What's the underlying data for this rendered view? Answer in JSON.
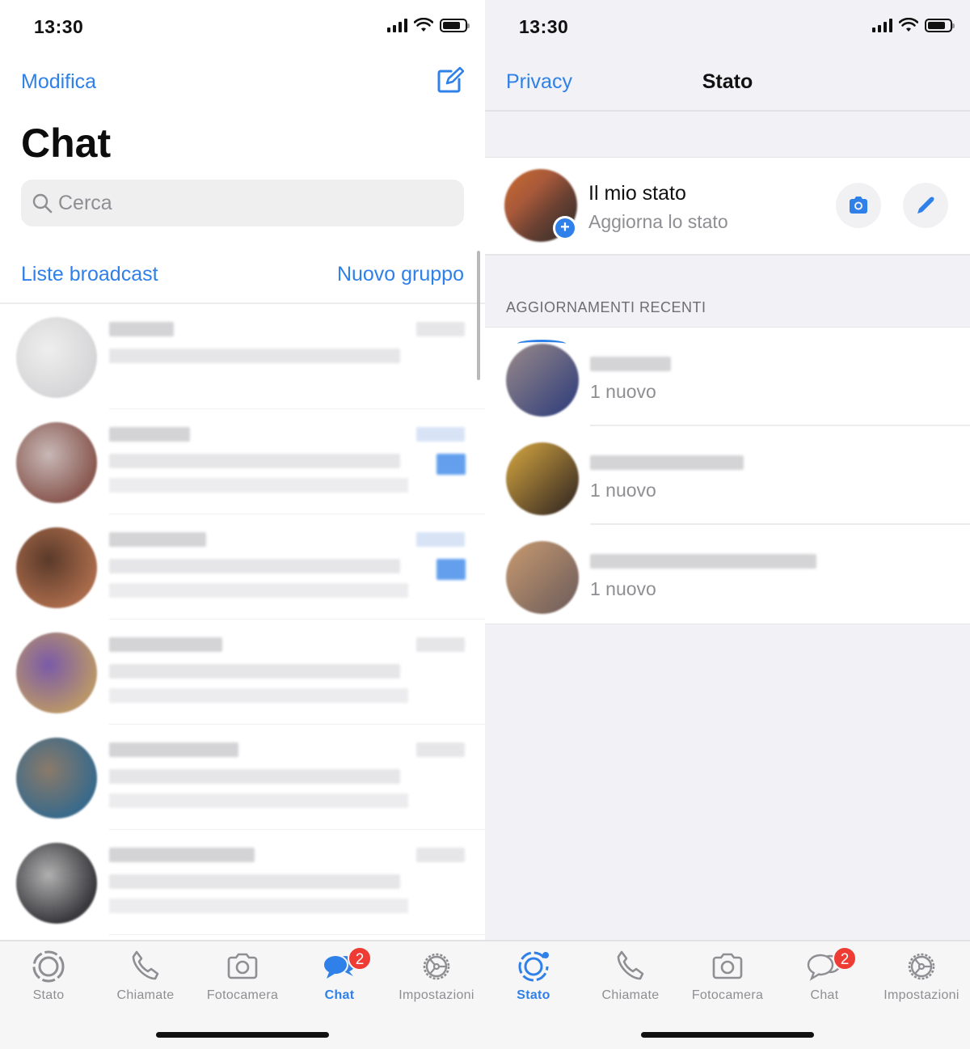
{
  "status_bar": {
    "time": "13:30"
  },
  "chat_screen": {
    "edit_label": "Modifica",
    "title": "Chat",
    "search_placeholder": "Cerca",
    "broadcast_label": "Liste broadcast",
    "new_group_label": "Nuovo gruppo",
    "chats": [
      {
        "name": "[blurred]",
        "preview": "[blurred]",
        "avatar_colors": [
          "#d6d6d8",
          "#eeeeee"
        ]
      },
      {
        "name": "[blurred]",
        "preview": "[blurred]",
        "avatar_colors": [
          "#8a5a52",
          "#c8b8b6"
        ],
        "unread": true
      },
      {
        "name": "[blurred]",
        "preview": "[blurred]",
        "avatar_colors": [
          "#a86a4a",
          "#5a3a2a"
        ],
        "unread": true
      },
      {
        "name": "[blurred]",
        "preview": "[blurred]",
        "avatar_colors": [
          "#b8956a",
          "#7a5aa8"
        ]
      },
      {
        "name": "[blurred]",
        "preview": "[blurred]",
        "avatar_colors": [
          "#3a6a8a",
          "#8a7a6a"
        ]
      },
      {
        "name": "[blurred]",
        "preview": "[blurred]",
        "avatar_colors": [
          "#3a3a3e",
          "#b0b0b0"
        ]
      }
    ]
  },
  "status_screen": {
    "privacy_label": "Privacy",
    "title": "Stato",
    "my_status": {
      "name": "Il mio stato",
      "subtitle": "Aggiorna lo stato"
    },
    "section_header": "AGGIORNAMENTI RECENTI",
    "updates": [
      {
        "name": "[blurred]",
        "subtitle": "1 nuovo",
        "avatar_colors": [
          "#9a8a8a",
          "#2a3a7a"
        ]
      },
      {
        "name": "[blurred]",
        "subtitle": "1 nuovo",
        "avatar_colors": [
          "#d8a840",
          "#2a2020"
        ]
      },
      {
        "name": "[blurred]",
        "subtitle": "1 nuovo",
        "avatar_colors": [
          "#c89a70",
          "#6a5a5a"
        ]
      }
    ]
  },
  "tabbar_left": {
    "active": "chat",
    "tabs": [
      {
        "id": "stato",
        "label": "Stato"
      },
      {
        "id": "chiamate",
        "label": "Chiamate"
      },
      {
        "id": "fotocamera",
        "label": "Fotocamera"
      },
      {
        "id": "chat",
        "label": "Chat",
        "badge": "2"
      },
      {
        "id": "impostazioni",
        "label": "Impostazioni"
      }
    ]
  },
  "tabbar_right": {
    "active": "stato",
    "tabs": [
      {
        "id": "stato",
        "label": "Stato"
      },
      {
        "id": "chiamate",
        "label": "Chiamate"
      },
      {
        "id": "fotocamera",
        "label": "Fotocamera"
      },
      {
        "id": "chat",
        "label": "Chat",
        "badge": "2"
      },
      {
        "id": "impostazioni",
        "label": "Impostazioni"
      }
    ]
  },
  "colors": {
    "accent": "#2f80e8",
    "badge": "#ee3b33",
    "inactive": "#8e8e93"
  }
}
